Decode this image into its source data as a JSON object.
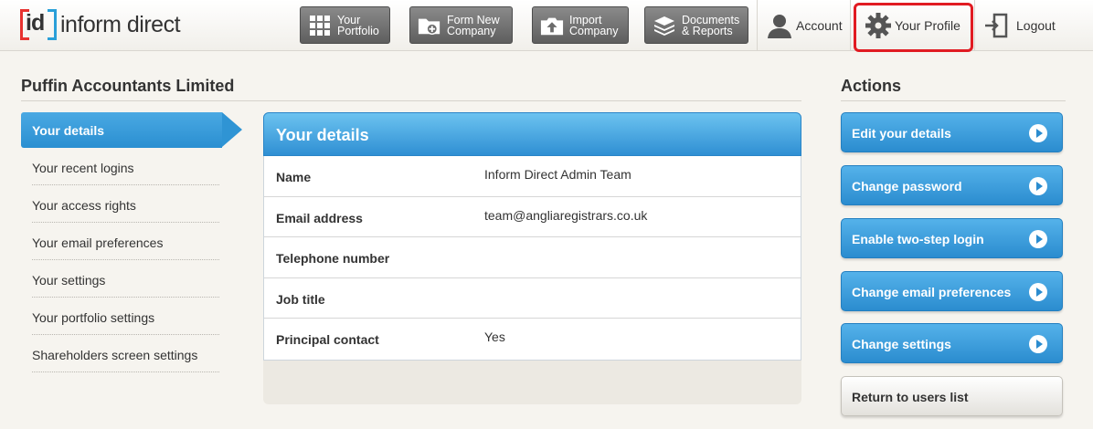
{
  "brand": {
    "logo_mark": "id",
    "name": "inform direct"
  },
  "nav": {
    "portfolio": {
      "label": "Your\nPortfolio",
      "icon": "grid-icon"
    },
    "form_new": {
      "label": "Form New\nCompany",
      "icon": "folder-plus-icon"
    },
    "import": {
      "label": "Import\nCompany",
      "icon": "upload-icon"
    },
    "documents": {
      "label": "Documents\n& Reports",
      "icon": "stack-icon"
    }
  },
  "top_links": {
    "account": "Account",
    "profile": "Your Profile",
    "logout": "Logout"
  },
  "company_title": "Puffin Accountants Limited",
  "actions_title": "Actions",
  "sidebar": {
    "active": "Your details",
    "items": [
      "Your recent logins",
      "Your access rights",
      "Your email preferences",
      "Your settings",
      "Your portfolio settings",
      "Shareholders screen settings"
    ]
  },
  "details": {
    "title": "Your details",
    "rows": [
      {
        "label": "Name",
        "value": "Inform Direct Admin Team"
      },
      {
        "label": "Email address",
        "value": "team@angliaregistrars.co.uk"
      },
      {
        "label": "Telephone number",
        "value": ""
      },
      {
        "label": "Job title",
        "value": ""
      },
      {
        "label": "Principal contact",
        "value": "Yes"
      }
    ]
  },
  "actions": [
    "Edit your details",
    "Change password",
    "Enable two-step login",
    "Change email preferences",
    "Change settings"
  ],
  "return_button": "Return to users list",
  "colors": {
    "accent_blue": "#2b8ccf",
    "highlight_red": "#e11b22",
    "logo_red": "#e7322f",
    "logo_blue": "#2a9fd8"
  }
}
